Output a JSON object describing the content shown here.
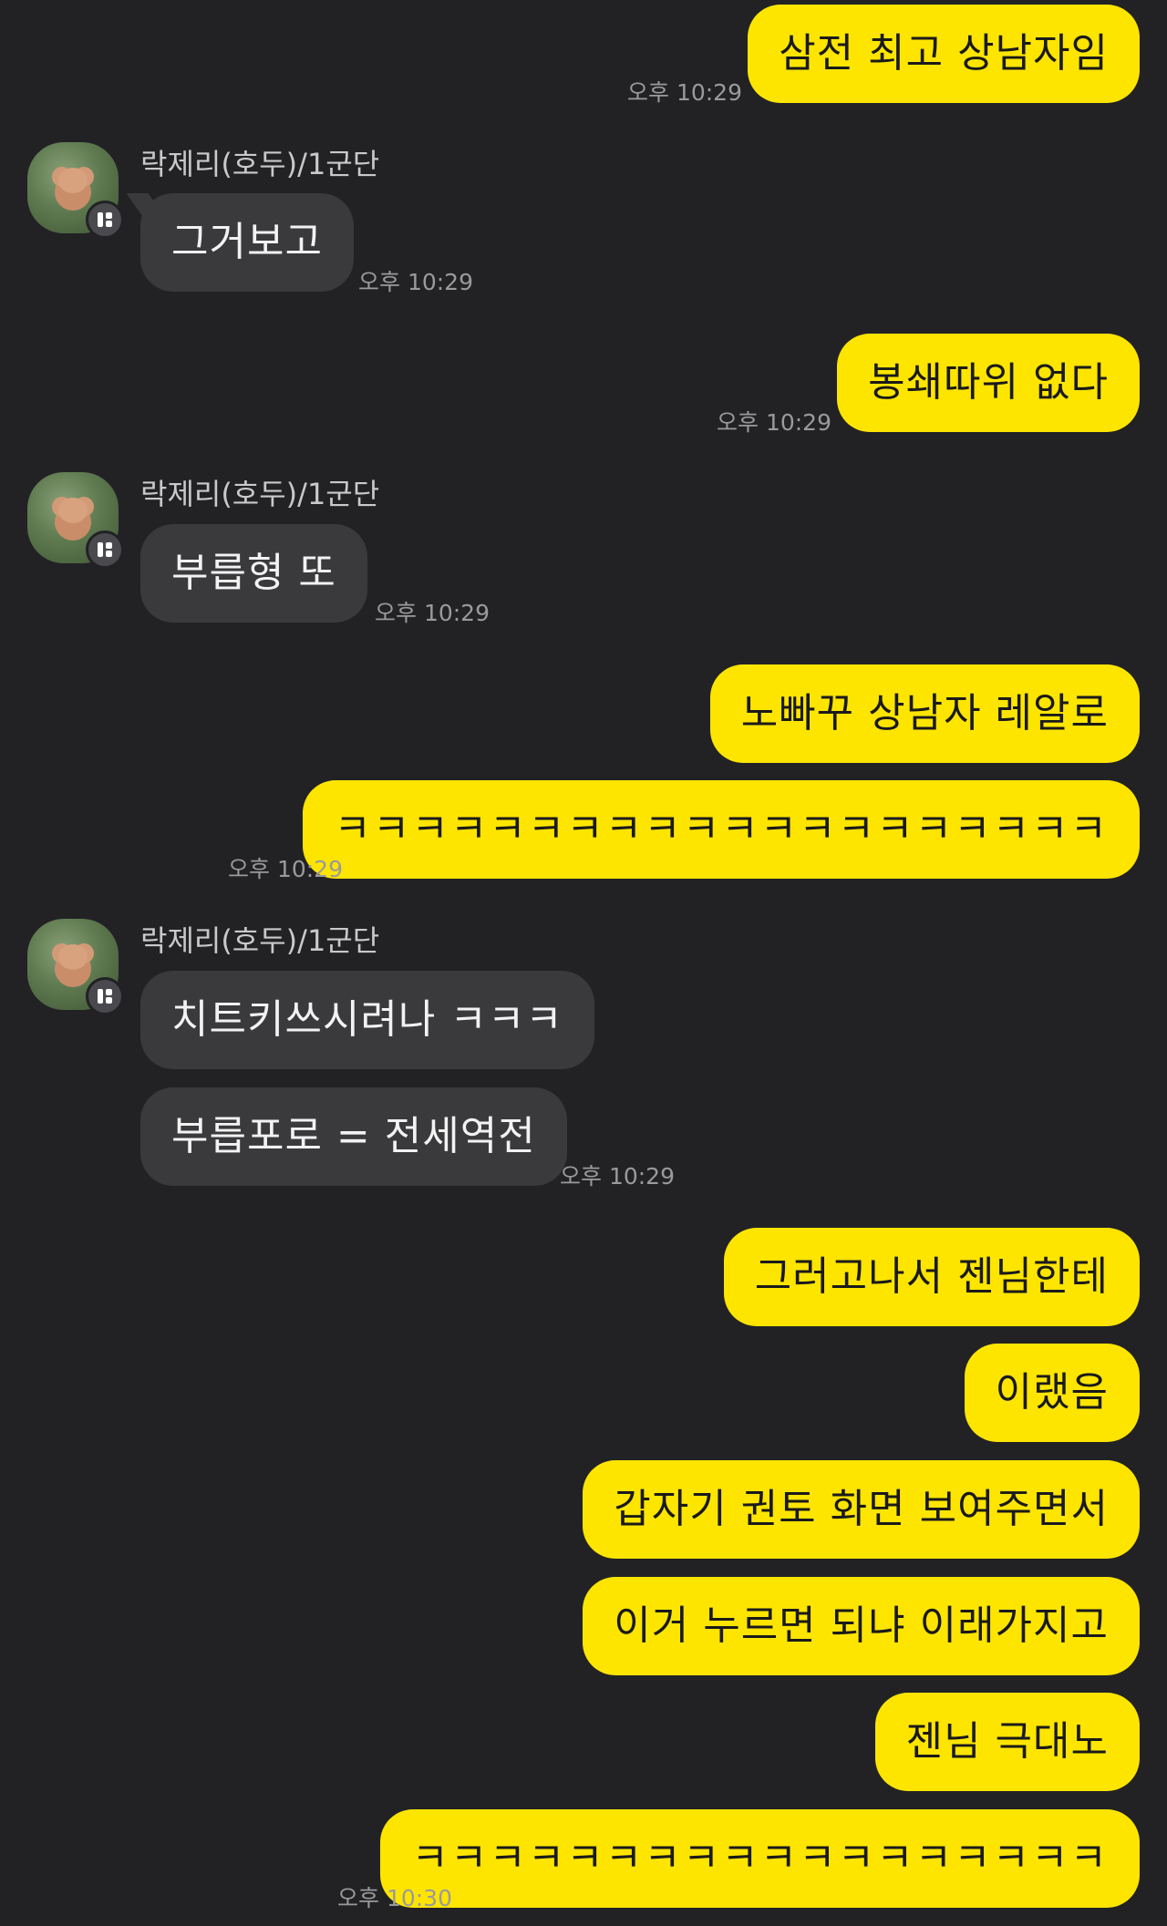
{
  "sender_name": "락제리(호두)/1군단",
  "colors": {
    "background": "#222225",
    "outgoing_bubble": "#fee500",
    "incoming_bubble": "#3a3a3d",
    "timestamp": "#9a9a9d"
  },
  "messages": [
    {
      "dir": "out",
      "text": "삼전 최고 상남자임",
      "time": "오후 10:29"
    },
    {
      "dir": "in",
      "text": "그거보고",
      "time": "오후 10:29"
    },
    {
      "dir": "out",
      "text": "봉쇄따위 없다",
      "time": "오후 10:29"
    },
    {
      "dir": "in",
      "text": "부릅형 또",
      "time": "오후 10:29"
    },
    {
      "dir": "out",
      "text": "노빠꾸 상남자 레알로",
      "time": ""
    },
    {
      "dir": "out",
      "text": "ㅋㅋㅋㅋㅋㅋㅋㅋㅋㅋㅋㅋㅋㅋㅋㅋㅋㅋㅋㅋ",
      "time": "오후 10:29"
    },
    {
      "dir": "in",
      "text": "치트키쓰시려나 ㅋㅋㅋ",
      "time": ""
    },
    {
      "dir": "in",
      "text": "부릅포로 = 전세역전",
      "time": "오후 10:29"
    },
    {
      "dir": "out",
      "text": "그러고나서 젠님한테",
      "time": ""
    },
    {
      "dir": "out",
      "text": "이랬음",
      "time": ""
    },
    {
      "dir": "out",
      "text": "갑자기 권토 화면 보여주면서",
      "time": ""
    },
    {
      "dir": "out",
      "text": "이거 누르면 되냐 이래가지고",
      "time": ""
    },
    {
      "dir": "out",
      "text": "젠님 극대노",
      "time": ""
    },
    {
      "dir": "out",
      "text": "ㅋㅋㅋㅋㅋㅋㅋㅋㅋㅋㅋㅋㅋㅋㅋㅋㅋㅋ",
      "time": "오후 10:30"
    }
  ]
}
